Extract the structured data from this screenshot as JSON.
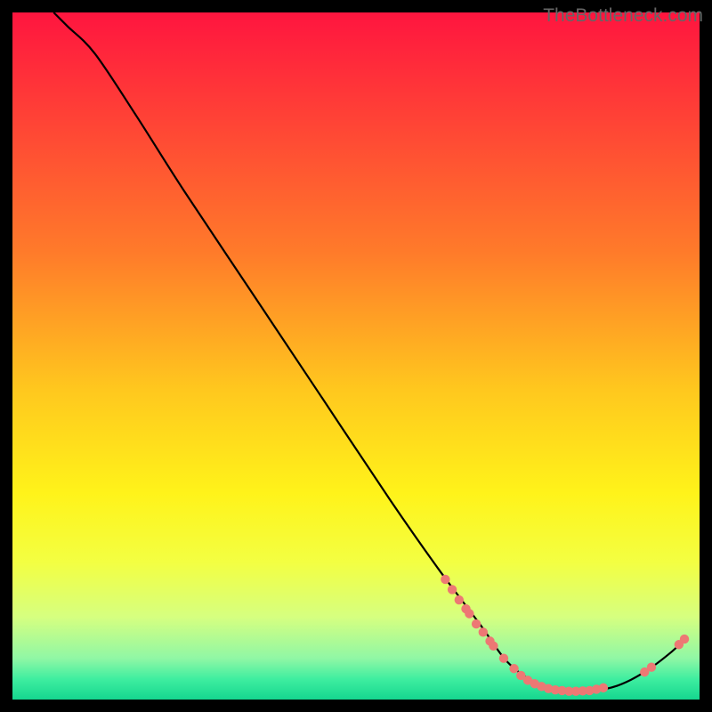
{
  "watermark": "TheBottleneck.com",
  "chart_data": {
    "type": "line",
    "title": "",
    "xlabel": "",
    "ylabel": "",
    "xlim": [
      0,
      100
    ],
    "ylim": [
      0,
      100
    ],
    "curve": {
      "name": "bottleneck-curve",
      "points": [
        {
          "x": 6,
          "y": 100
        },
        {
          "x": 8,
          "y": 98
        },
        {
          "x": 12,
          "y": 94
        },
        {
          "x": 18,
          "y": 85
        },
        {
          "x": 25,
          "y": 74
        },
        {
          "x": 35,
          "y": 59
        },
        {
          "x": 45,
          "y": 44
        },
        {
          "x": 55,
          "y": 29
        },
        {
          "x": 62,
          "y": 19
        },
        {
          "x": 68,
          "y": 11
        },
        {
          "x": 72,
          "y": 5.5
        },
        {
          "x": 76,
          "y": 2.5
        },
        {
          "x": 80,
          "y": 1.2
        },
        {
          "x": 84,
          "y": 1.2
        },
        {
          "x": 88,
          "y": 2
        },
        {
          "x": 92,
          "y": 4
        },
        {
          "x": 96,
          "y": 7
        },
        {
          "x": 98,
          "y": 9
        }
      ]
    },
    "markers": {
      "name": "data-markers",
      "color": "#ed7874",
      "points": [
        {
          "x": 63,
          "y": 17.5
        },
        {
          "x": 64,
          "y": 16
        },
        {
          "x": 65,
          "y": 14.5
        },
        {
          "x": 66,
          "y": 13.2
        },
        {
          "x": 66.5,
          "y": 12.5
        },
        {
          "x": 67.5,
          "y": 11
        },
        {
          "x": 68.5,
          "y": 9.8
        },
        {
          "x": 69.5,
          "y": 8.5
        },
        {
          "x": 70,
          "y": 7.8
        },
        {
          "x": 71.5,
          "y": 6
        },
        {
          "x": 73,
          "y": 4.5
        },
        {
          "x": 74,
          "y": 3.5
        },
        {
          "x": 75,
          "y": 2.8
        },
        {
          "x": 76,
          "y": 2.3
        },
        {
          "x": 77,
          "y": 1.9
        },
        {
          "x": 78,
          "y": 1.6
        },
        {
          "x": 79,
          "y": 1.4
        },
        {
          "x": 80,
          "y": 1.3
        },
        {
          "x": 81,
          "y": 1.2
        },
        {
          "x": 82,
          "y": 1.2
        },
        {
          "x": 83,
          "y": 1.25
        },
        {
          "x": 84,
          "y": 1.3
        },
        {
          "x": 85,
          "y": 1.5
        },
        {
          "x": 86,
          "y": 1.7
        },
        {
          "x": 92,
          "y": 4
        },
        {
          "x": 93,
          "y": 4.7
        },
        {
          "x": 97,
          "y": 8
        },
        {
          "x": 97.8,
          "y": 8.8
        }
      ]
    },
    "gradient_stops": [
      {
        "offset": 0,
        "color": "#ff153f"
      },
      {
        "offset": 0.35,
        "color": "#ff7b2a"
      },
      {
        "offset": 0.55,
        "color": "#ffc81e"
      },
      {
        "offset": 0.7,
        "color": "#fff31a"
      },
      {
        "offset": 0.8,
        "color": "#f3ff42"
      },
      {
        "offset": 0.88,
        "color": "#d6ff80"
      },
      {
        "offset": 0.94,
        "color": "#90f7a5"
      },
      {
        "offset": 0.97,
        "color": "#3feea0"
      },
      {
        "offset": 1,
        "color": "#15d68f"
      }
    ]
  }
}
